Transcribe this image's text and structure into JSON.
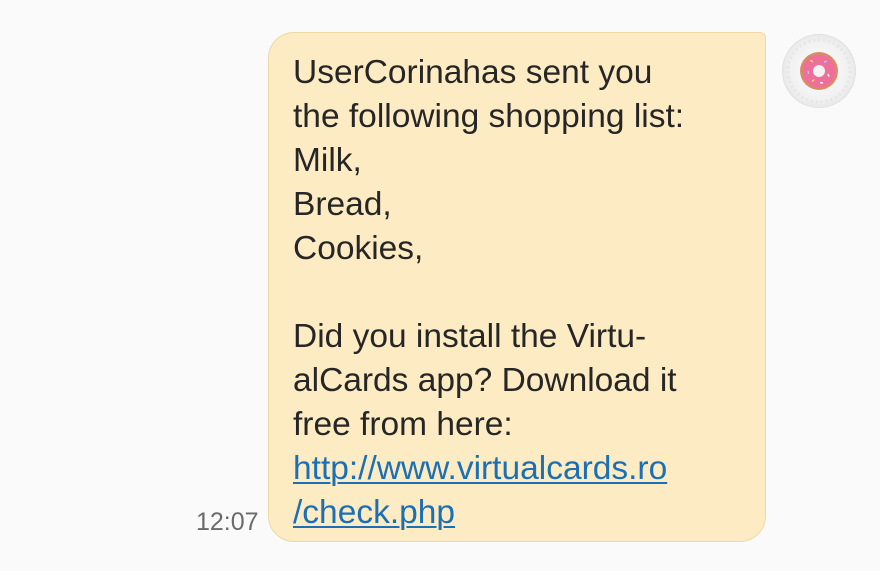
{
  "message": {
    "text": "UserCorinahas sent you\nthe following shopping list:\nMilk,\nBread,\nCookies,\n\nDid you install the Virtu-\nalCards app? Download it\nfree from here:",
    "link": "http://www.virtualcards.ro\n/check.php",
    "timestamp": "12:07",
    "bubble_color": "#fdecc3"
  },
  "sender": {
    "avatar_icon": "donut-icon"
  }
}
